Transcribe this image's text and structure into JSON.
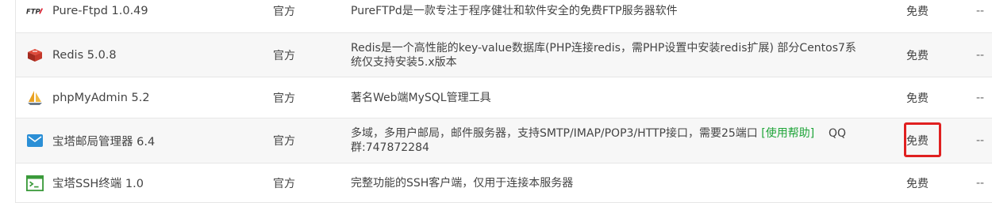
{
  "plugins": [
    {
      "name": "Pure-Ftpd 1.0.49",
      "icon": "ftp-icon",
      "type": "官方",
      "description": "PureFTPd是一款专注于程序健壮和软件安全的免费FTP服务器软件",
      "price": "免费",
      "action": "--"
    },
    {
      "name": "Redis 5.0.8",
      "icon": "redis-icon",
      "type": "官方",
      "description_line1": "Redis是一个高性能的key-value数据库(PHP连接redis，需PHP设置中安装redis扩展) 部分Centos7系",
      "description_line2": "统仅支持安装5.x版本",
      "price": "免费",
      "action": "--"
    },
    {
      "name": "phpMyAdmin 5.2",
      "icon": "sailboat-icon",
      "type": "官方",
      "description": "著名Web端MySQL管理工具",
      "price": "免费",
      "action": "--"
    },
    {
      "name": "宝塔邮局管理器 6.4",
      "icon": "mail-icon",
      "type": "官方",
      "description_part1": "多域，多用户邮局，邮件服务器，支持SMTP/IMAP/POP3/HTTP接口，需要25端口 ",
      "help_link": "[使用帮助]",
      "description_part2": "QQ",
      "description_line2": "群:747872284",
      "price": "免费",
      "action": "--"
    },
    {
      "name": "宝塔SSH终端 1.0",
      "icon": "terminal-icon",
      "type": "官方",
      "description": "完整功能的SSH客户端，仅用于连接本服务器",
      "price": "免费",
      "action": "--"
    }
  ],
  "colors": {
    "link": "#20a53a",
    "highlight": "#e02020"
  }
}
